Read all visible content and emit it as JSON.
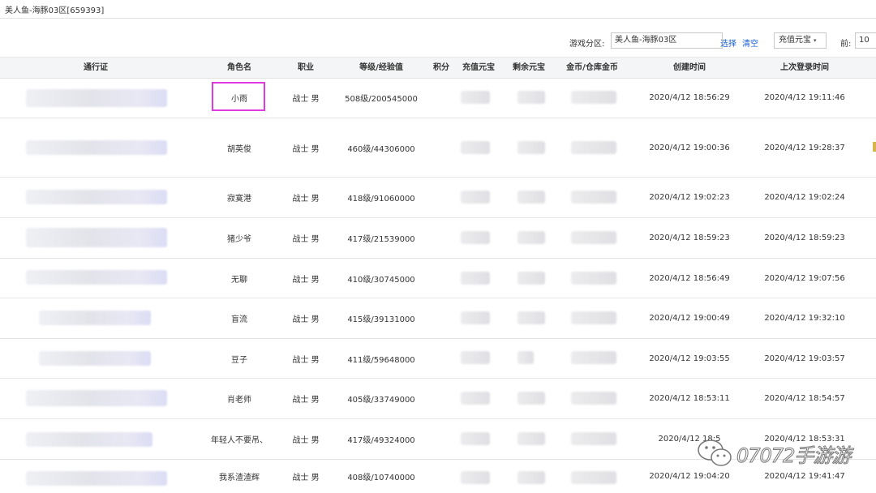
{
  "window": {
    "title": "美人鱼-海豚03区[659393]"
  },
  "filter": {
    "zone_label": "游戏分区:",
    "zone_value": "美人鱼-海豚03区",
    "select_label": "选择",
    "clear_label": "清空",
    "sort_value": "充值元宝",
    "prev_label": "前:",
    "page_value": "10"
  },
  "table": {
    "headers": {
      "pass": "通行证",
      "name": "角色名",
      "job": "职业",
      "level": "等级/经验值",
      "points": "积分",
      "recharge": "充值元宝",
      "remain": "剩余元宝",
      "gold": "金币/仓库金币",
      "created": "创建时间",
      "last_login": "上次登录时间"
    },
    "rows": [
      {
        "name": "小雨",
        "job": "战士 男",
        "level": "508级/200545000",
        "created": "2020/4/12 18:56:29",
        "last_login": "2020/4/12 19:11:46"
      },
      {
        "name": "胡英俊",
        "job": "战士 男",
        "level": "460级/44306000",
        "created": "2020/4/12 19:00:36",
        "last_login": "2020/4/12 19:28:37"
      },
      {
        "name": "寂寞港",
        "job": "战士 男",
        "level": "418级/91060000",
        "created": "2020/4/12 19:02:23",
        "last_login": "2020/4/12 19:02:24"
      },
      {
        "name": "猪少爷",
        "job": "战士 男",
        "level": "417级/21539000",
        "created": "2020/4/12 18:59:23",
        "last_login": "2020/4/12 18:59:23"
      },
      {
        "name": "无聊",
        "job": "战士 男",
        "level": "410级/30745000",
        "created": "2020/4/12 18:56:49",
        "last_login": "2020/4/12 19:07:56"
      },
      {
        "name": "盲流",
        "job": "战士 男",
        "level": "415级/39131000",
        "created": "2020/4/12 19:00:49",
        "last_login": "2020/4/12 19:32:10"
      },
      {
        "name": "豆子",
        "job": "战士 男",
        "level": "411级/59648000",
        "created": "2020/4/12 19:03:55",
        "last_login": "2020/4/12 19:03:57"
      },
      {
        "name": "肖老师",
        "job": "战士 男",
        "level": "405级/33749000",
        "created": "2020/4/12 18:53:11",
        "last_login": "2020/4/12 18:54:57"
      },
      {
        "name": "年轻人不要吊、",
        "job": "战士 男",
        "level": "417级/49324000",
        "created": "2020/4/12 18:5",
        "last_login": "2020/4/12 18:53:31"
      },
      {
        "name": "我系渣渣辉",
        "job": "战士 男",
        "level": "408级/10740000",
        "created": "2020/4/12 19:04:20",
        "last_login": "2020/4/12 19:41:47"
      }
    ]
  },
  "watermark": {
    "text": "07072手游游",
    "icon": "wechat-icon"
  },
  "colors": {
    "highlight": "#e13ae0",
    "link": "#1a5fcc",
    "header_bg": "#f3f5f7"
  }
}
